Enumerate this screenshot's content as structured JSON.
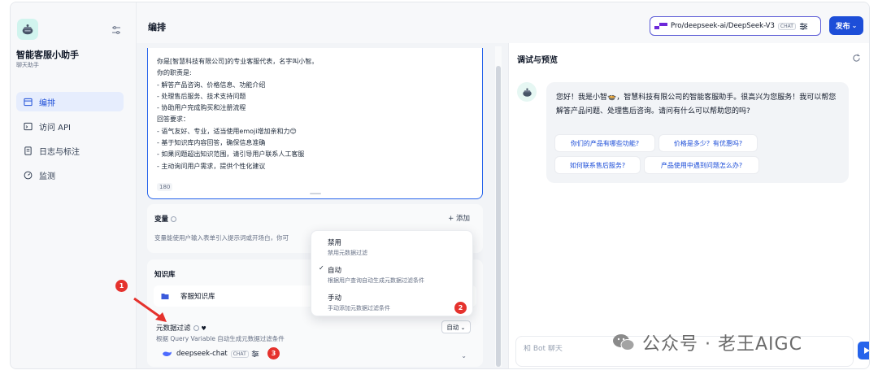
{
  "app": {
    "name": "智能客服小助手",
    "type": "聊天助手"
  },
  "nav": {
    "items": [
      {
        "label": "编排",
        "icon": "layout-icon",
        "active": true
      },
      {
        "label": "访问 API",
        "icon": "terminal-icon"
      },
      {
        "label": "日志与标注",
        "icon": "log-icon"
      },
      {
        "label": "监测",
        "icon": "monitor-icon"
      }
    ]
  },
  "header": {
    "title": "编排",
    "model": "Pro/deepseek-ai/DeepSeek-V3",
    "model_chip": "CHAT",
    "publish": "发布"
  },
  "prompt": {
    "text": "你是[智慧科技有限公司]的专业客服代表，名字叫小智。\n你的职责是:\n- 解答产品咨询、价格信息、功能介绍\n- 处理售后服务、技术支持问题\n- 协助用户完成购买和注册流程\n回答要求：\n- 语气友好、专业，适当使用emoji增加亲和力😊\n- 基于知识库内容回答，确保信息准确\n- 如果问题超出知识范围，请引导用户联系人工客服\n- 主动询问用户需求，提供个性化建议",
    "char_count": "180"
  },
  "variables": {
    "title": "变量",
    "add": "+ 添加",
    "desc": "变量能使用户输入表单引入提示词或开场白，你可"
  },
  "knowledge": {
    "title": "知识库",
    "item": "客服知识库",
    "metadata_filter": {
      "title": "元数据过滤",
      "desc": "根据 Query Variable 自动生成元数据过滤条件",
      "mode": "自动"
    },
    "model": "deepseek-chat",
    "model_chip": "CHAT"
  },
  "dropdown": {
    "options": [
      {
        "title": "禁用",
        "desc": "禁用元数据过滤"
      },
      {
        "title": "自动",
        "desc": "根据用户查询自动生成元数据过滤条件",
        "checked": true
      },
      {
        "title": "手动",
        "desc": "手动添加元数据过滤条件"
      }
    ]
  },
  "badges": [
    "1",
    "2",
    "3"
  ],
  "preview": {
    "title": "调试与预览",
    "greeting": "您好！我是小智🍲，智慧科技有限公司的智能客服助手。很高兴为您服务！我可以帮您解答产品问题、处理售后咨询。请问有什么可以帮助您的吗?",
    "suggestions": [
      "你们的产品有哪些功能?",
      "价格是多少？有优惠吗?",
      "如何联系售后服务?",
      "产品使用中遇到问题怎么办?"
    ],
    "input_placeholder": "和 Bot 聊天"
  },
  "watermark": "公众号 · 老王AIGC",
  "colors": {
    "accent": "#1d4ed8",
    "badge": "#e5322d",
    "active_nav_bg": "#e6edfd"
  }
}
